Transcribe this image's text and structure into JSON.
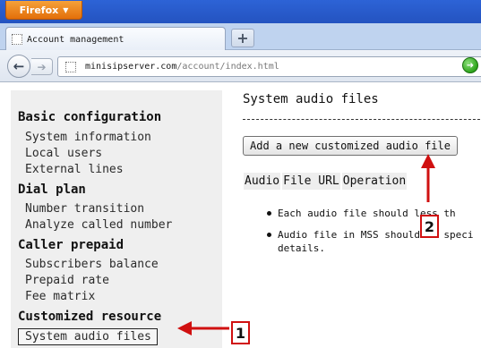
{
  "browser": {
    "app_button": "Firefox",
    "tab_title": "Account management",
    "new_tab_label": "+",
    "url_domain": "minisipserver.com",
    "url_path": "/account/index.html"
  },
  "sidebar": {
    "sections": [
      {
        "heading": "Basic configuration",
        "items": [
          "System information",
          "Local users",
          "External lines"
        ]
      },
      {
        "heading": "Dial plan",
        "items": [
          "Number transition",
          "Analyze called number"
        ]
      },
      {
        "heading": "Caller prepaid",
        "items": [
          "Subscribers balance",
          "Prepaid rate",
          "Fee matrix"
        ]
      },
      {
        "heading": "Customized resource",
        "items": [
          "System audio files"
        ]
      }
    ]
  },
  "main": {
    "title": "System audio files",
    "add_button": "Add a new customized audio file",
    "columns": [
      "Audio",
      "File URL",
      "Operation"
    ],
    "notes": [
      "Each audio file should less th",
      "Audio file in MSS should be speci\ndetails."
    ]
  },
  "annotations": {
    "callout_1": "1",
    "callout_2": "2",
    "color": "#d01010"
  }
}
